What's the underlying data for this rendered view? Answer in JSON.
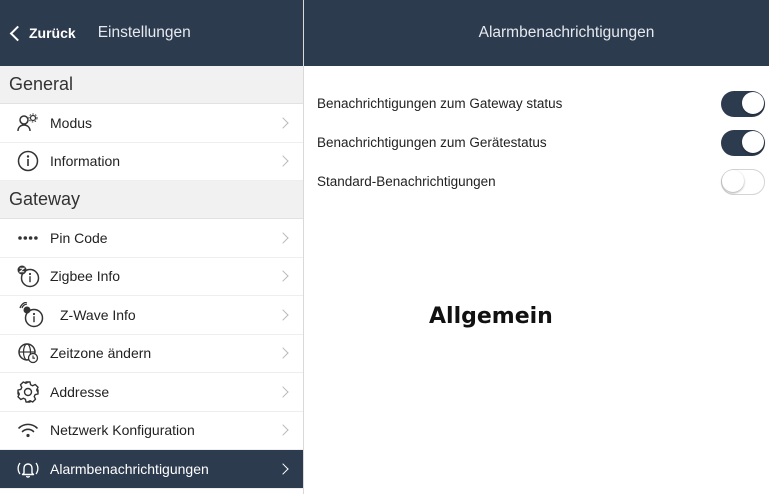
{
  "sidebar": {
    "back_label": "Zurück",
    "title": "Einstellungen",
    "sections": [
      {
        "header": "General",
        "items": [
          {
            "label": "Modus",
            "icon": "users-gear-icon"
          },
          {
            "label": "Information",
            "icon": "info-circle-icon"
          }
        ]
      },
      {
        "header": "Gateway",
        "items": [
          {
            "label": "Pin Code",
            "icon": "dots-icon"
          },
          {
            "label": "Zigbee Info",
            "icon": "zigbee-info-icon"
          },
          {
            "label": "Z-Wave Info",
            "icon": "zwave-info-icon"
          },
          {
            "label": "Zeitzone ändern",
            "icon": "globe-clock-icon"
          },
          {
            "label": "Addresse",
            "icon": "gear-icon"
          },
          {
            "label": "Netzwerk Konfiguration",
            "icon": "wifi-icon"
          },
          {
            "label": "Alarmbenachrichtigungen",
            "icon": "alarm-bell-icon",
            "active": true
          }
        ]
      }
    ]
  },
  "main": {
    "title": "Alarmbenachrichtigungen",
    "settings": [
      {
        "label": "Benachrichtigungen zum Gateway status",
        "enabled": true
      },
      {
        "label": "Benachrichtigungen zum Gerätestatus",
        "enabled": true
      },
      {
        "label": "Standard-Benachrichtigungen",
        "enabled": false
      }
    ],
    "overlay_text": "Allgemein"
  },
  "colors": {
    "nav_background": "#2d3b4f",
    "section_background": "#f1f1f2",
    "toggle_on": "#2d3b4f"
  }
}
